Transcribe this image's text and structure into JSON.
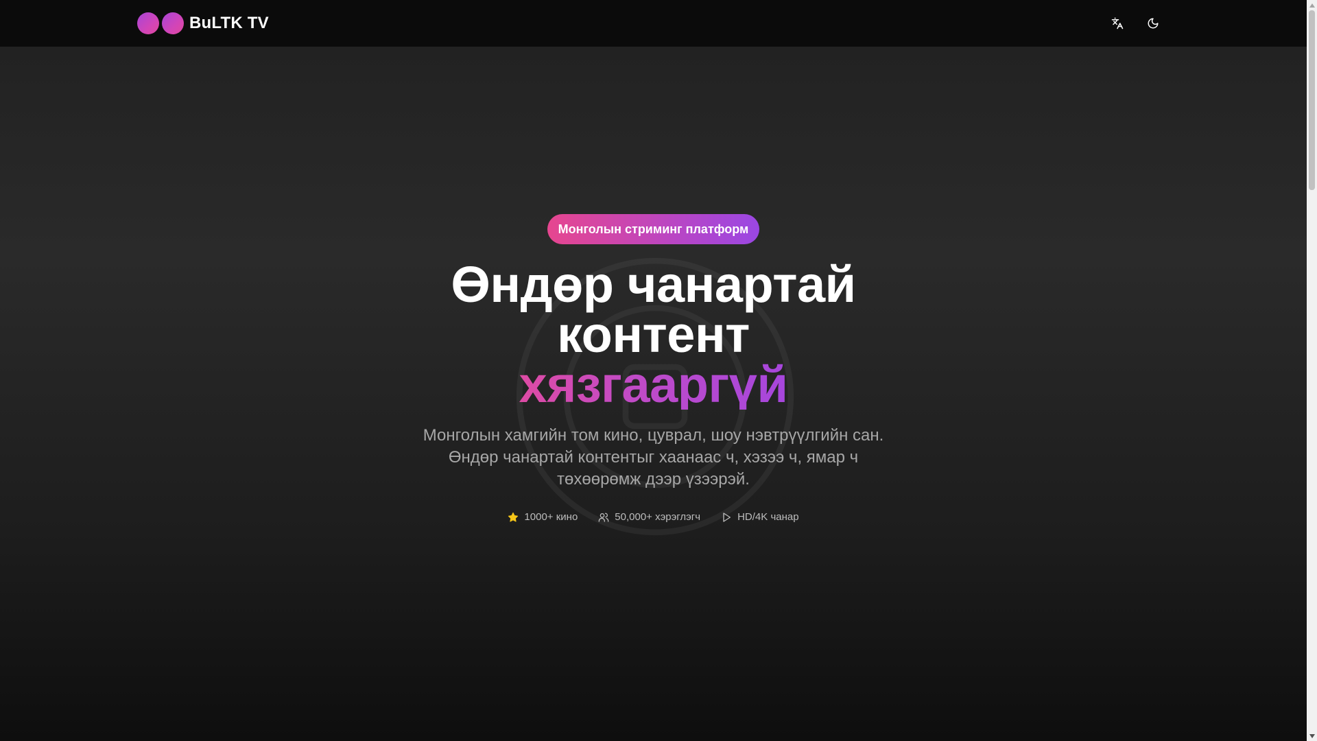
{
  "header": {
    "brand_name": "BuLTK TV",
    "translate_icon": "translate-icon",
    "theme_icon": "moon-icon"
  },
  "hero": {
    "badge": "Монголын стриминг платформ",
    "headline_line1": "Өндөр чанартай",
    "headline_line2": "контент",
    "headline_line3": "хязгааргүй",
    "subtitle": "Монголын хамгийн том кино, цуврал, шоу нэвтрүүлгийн сан. Өндөр чанартай контентыг хаанаас ч, хэзээ ч, ямар ч төхөөрөмж дээр үзээрэй.",
    "stats": [
      {
        "icon": "star-icon",
        "label": "1000+ кино"
      },
      {
        "icon": "users-icon",
        "label": "50,000+ хэрэглэгч"
      },
      {
        "icon": "play-icon",
        "label": "HD/4K чанар"
      }
    ]
  },
  "colors": {
    "background": "#0b0b0b",
    "accent_pink": "#e6468f",
    "accent_purple": "#9a47e3",
    "star": "#f5c518",
    "muted_text": "#a7a7a7"
  }
}
